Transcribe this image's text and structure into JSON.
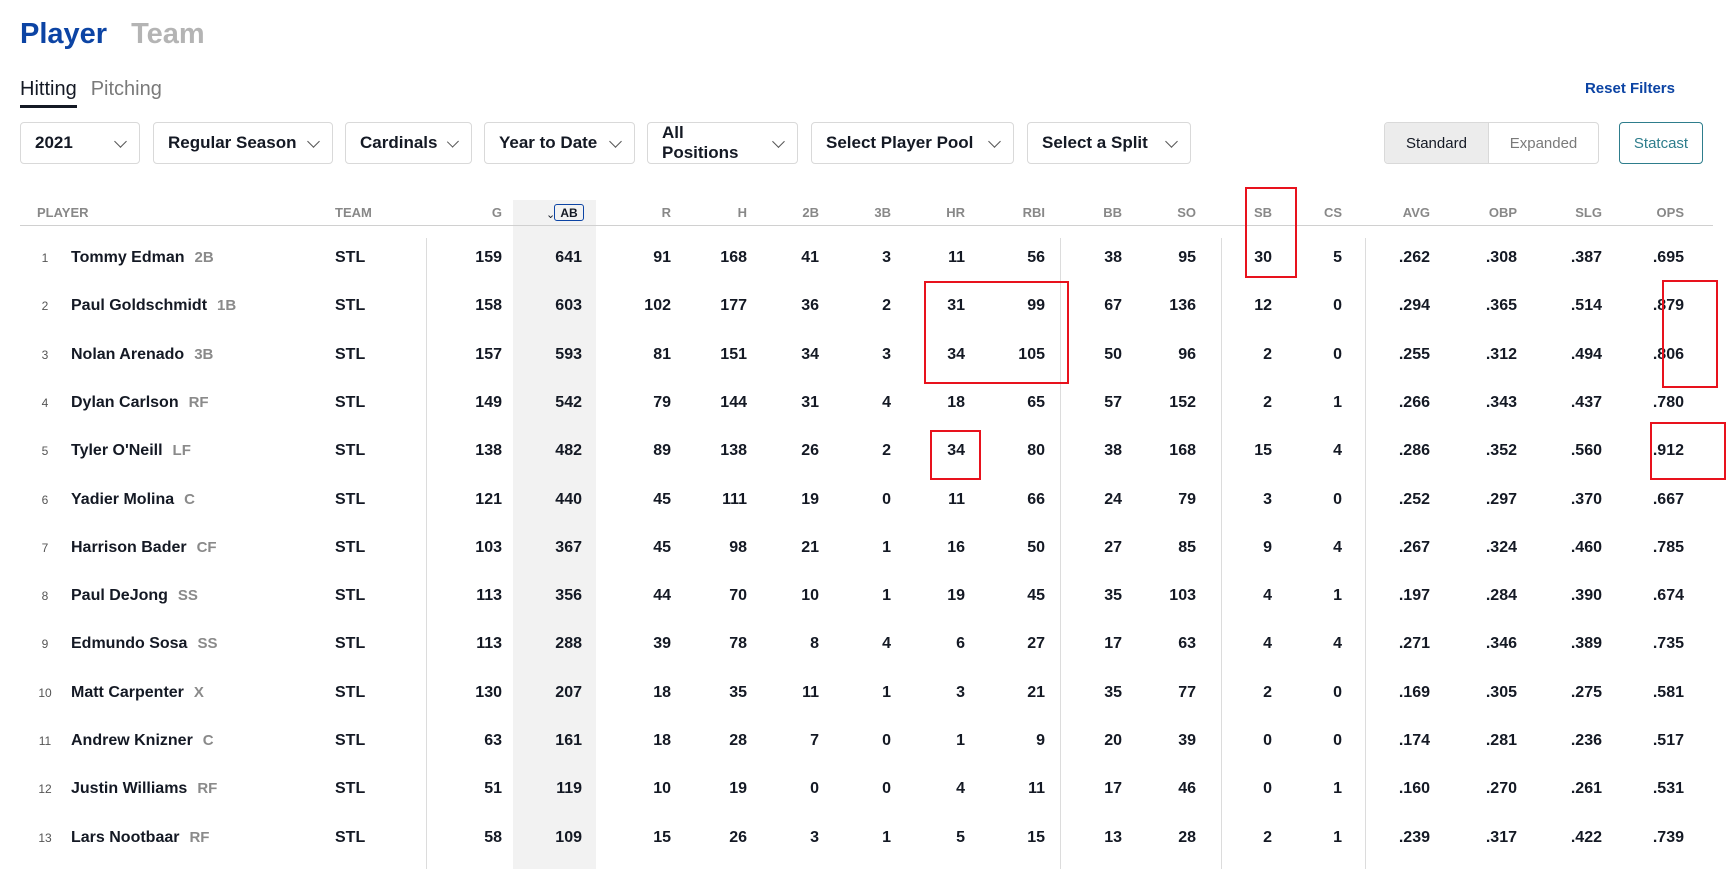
{
  "tabs": {
    "player": "Player",
    "team": "Team"
  },
  "subtabs": {
    "hitting": "Hitting",
    "pitching": "Pitching"
  },
  "reset_filters": "Reset Filters",
  "filters": {
    "season": "2021",
    "game_type": "Regular Season",
    "team": "Cardinals",
    "period": "Year to Date",
    "positions": "All Positions",
    "player_pool": "Select Player Pool",
    "split": "Select a Split"
  },
  "view_toggle": {
    "standard": "Standard",
    "expanded": "Expanded"
  },
  "statcast": "Statcast",
  "columns": [
    "PLAYER",
    "TEAM",
    "G",
    "AB",
    "R",
    "H",
    "2B",
    "3B",
    "HR",
    "RBI",
    "BB",
    "SO",
    "SB",
    "CS",
    "AVG",
    "OBP",
    "SLG",
    "OPS"
  ],
  "rows": [
    {
      "rank": "1",
      "name": "Tommy Edman",
      "pos": "2B",
      "team": "STL",
      "g": "159",
      "ab": "641",
      "r": "91",
      "h": "168",
      "d": "41",
      "t": "3",
      "hr": "11",
      "rbi": "56",
      "bb": "38",
      "so": "95",
      "sb": "30",
      "cs": "5",
      "avg": ".262",
      "obp": ".308",
      "slg": ".387",
      "ops": ".695"
    },
    {
      "rank": "2",
      "name": "Paul Goldschmidt",
      "pos": "1B",
      "team": "STL",
      "g": "158",
      "ab": "603",
      "r": "102",
      "h": "177",
      "d": "36",
      "t": "2",
      "hr": "31",
      "rbi": "99",
      "bb": "67",
      "so": "136",
      "sb": "12",
      "cs": "0",
      "avg": ".294",
      "obp": ".365",
      "slg": ".514",
      "ops": ".879"
    },
    {
      "rank": "3",
      "name": "Nolan Arenado",
      "pos": "3B",
      "team": "STL",
      "g": "157",
      "ab": "593",
      "r": "81",
      "h": "151",
      "d": "34",
      "t": "3",
      "hr": "34",
      "rbi": "105",
      "bb": "50",
      "so": "96",
      "sb": "2",
      "cs": "0",
      "avg": ".255",
      "obp": ".312",
      "slg": ".494",
      "ops": ".806"
    },
    {
      "rank": "4",
      "name": "Dylan Carlson",
      "pos": "RF",
      "team": "STL",
      "g": "149",
      "ab": "542",
      "r": "79",
      "h": "144",
      "d": "31",
      "t": "4",
      "hr": "18",
      "rbi": "65",
      "bb": "57",
      "so": "152",
      "sb": "2",
      "cs": "1",
      "avg": ".266",
      "obp": ".343",
      "slg": ".437",
      "ops": ".780"
    },
    {
      "rank": "5",
      "name": "Tyler O'Neill",
      "pos": "LF",
      "team": "STL",
      "g": "138",
      "ab": "482",
      "r": "89",
      "h": "138",
      "d": "26",
      "t": "2",
      "hr": "34",
      "rbi": "80",
      "bb": "38",
      "so": "168",
      "sb": "15",
      "cs": "4",
      "avg": ".286",
      "obp": ".352",
      "slg": ".560",
      "ops": ".912"
    },
    {
      "rank": "6",
      "name": "Yadier Molina",
      "pos": "C",
      "team": "STL",
      "g": "121",
      "ab": "440",
      "r": "45",
      "h": "111",
      "d": "19",
      "t": "0",
      "hr": "11",
      "rbi": "66",
      "bb": "24",
      "so": "79",
      "sb": "3",
      "cs": "0",
      "avg": ".252",
      "obp": ".297",
      "slg": ".370",
      "ops": ".667"
    },
    {
      "rank": "7",
      "name": "Harrison Bader",
      "pos": "CF",
      "team": "STL",
      "g": "103",
      "ab": "367",
      "r": "45",
      "h": "98",
      "d": "21",
      "t": "1",
      "hr": "16",
      "rbi": "50",
      "bb": "27",
      "so": "85",
      "sb": "9",
      "cs": "4",
      "avg": ".267",
      "obp": ".324",
      "slg": ".460",
      "ops": ".785"
    },
    {
      "rank": "8",
      "name": "Paul DeJong",
      "pos": "SS",
      "team": "STL",
      "g": "113",
      "ab": "356",
      "r": "44",
      "h": "70",
      "d": "10",
      "t": "1",
      "hr": "19",
      "rbi": "45",
      "bb": "35",
      "so": "103",
      "sb": "4",
      "cs": "1",
      "avg": ".197",
      "obp": ".284",
      "slg": ".390",
      "ops": ".674"
    },
    {
      "rank": "9",
      "name": "Edmundo Sosa",
      "pos": "SS",
      "team": "STL",
      "g": "113",
      "ab": "288",
      "r": "39",
      "h": "78",
      "d": "8",
      "t": "4",
      "hr": "6",
      "rbi": "27",
      "bb": "17",
      "so": "63",
      "sb": "4",
      "cs": "4",
      "avg": ".271",
      "obp": ".346",
      "slg": ".389",
      "ops": ".735"
    },
    {
      "rank": "10",
      "name": "Matt Carpenter",
      "pos": "X",
      "team": "STL",
      "g": "130",
      "ab": "207",
      "r": "18",
      "h": "35",
      "d": "11",
      "t": "1",
      "hr": "3",
      "rbi": "21",
      "bb": "35",
      "so": "77",
      "sb": "2",
      "cs": "0",
      "avg": ".169",
      "obp": ".305",
      "slg": ".275",
      "ops": ".581"
    },
    {
      "rank": "11",
      "name": "Andrew Knizner",
      "pos": "C",
      "team": "STL",
      "g": "63",
      "ab": "161",
      "r": "18",
      "h": "28",
      "d": "7",
      "t": "0",
      "hr": "1",
      "rbi": "9",
      "bb": "20",
      "so": "39",
      "sb": "0",
      "cs": "0",
      "avg": ".174",
      "obp": ".281",
      "slg": ".236",
      "ops": ".517"
    },
    {
      "rank": "12",
      "name": "Justin Williams",
      "pos": "RF",
      "team": "STL",
      "g": "51",
      "ab": "119",
      "r": "10",
      "h": "19",
      "d": "0",
      "t": "0",
      "hr": "4",
      "rbi": "11",
      "bb": "17",
      "so": "46",
      "sb": "0",
      "cs": "1",
      "avg": ".160",
      "obp": ".270",
      "slg": ".261",
      "ops": ".531"
    },
    {
      "rank": "13",
      "name": "Lars Nootbaar",
      "pos": "RF",
      "team": "STL",
      "g": "58",
      "ab": "109",
      "r": "15",
      "h": "26",
      "d": "3",
      "t": "1",
      "hr": "5",
      "rbi": "15",
      "bb": "13",
      "so": "28",
      "sb": "2",
      "cs": "1",
      "avg": ".239",
      "obp": ".317",
      "slg": ".422",
      "ops": ".739"
    }
  ]
}
